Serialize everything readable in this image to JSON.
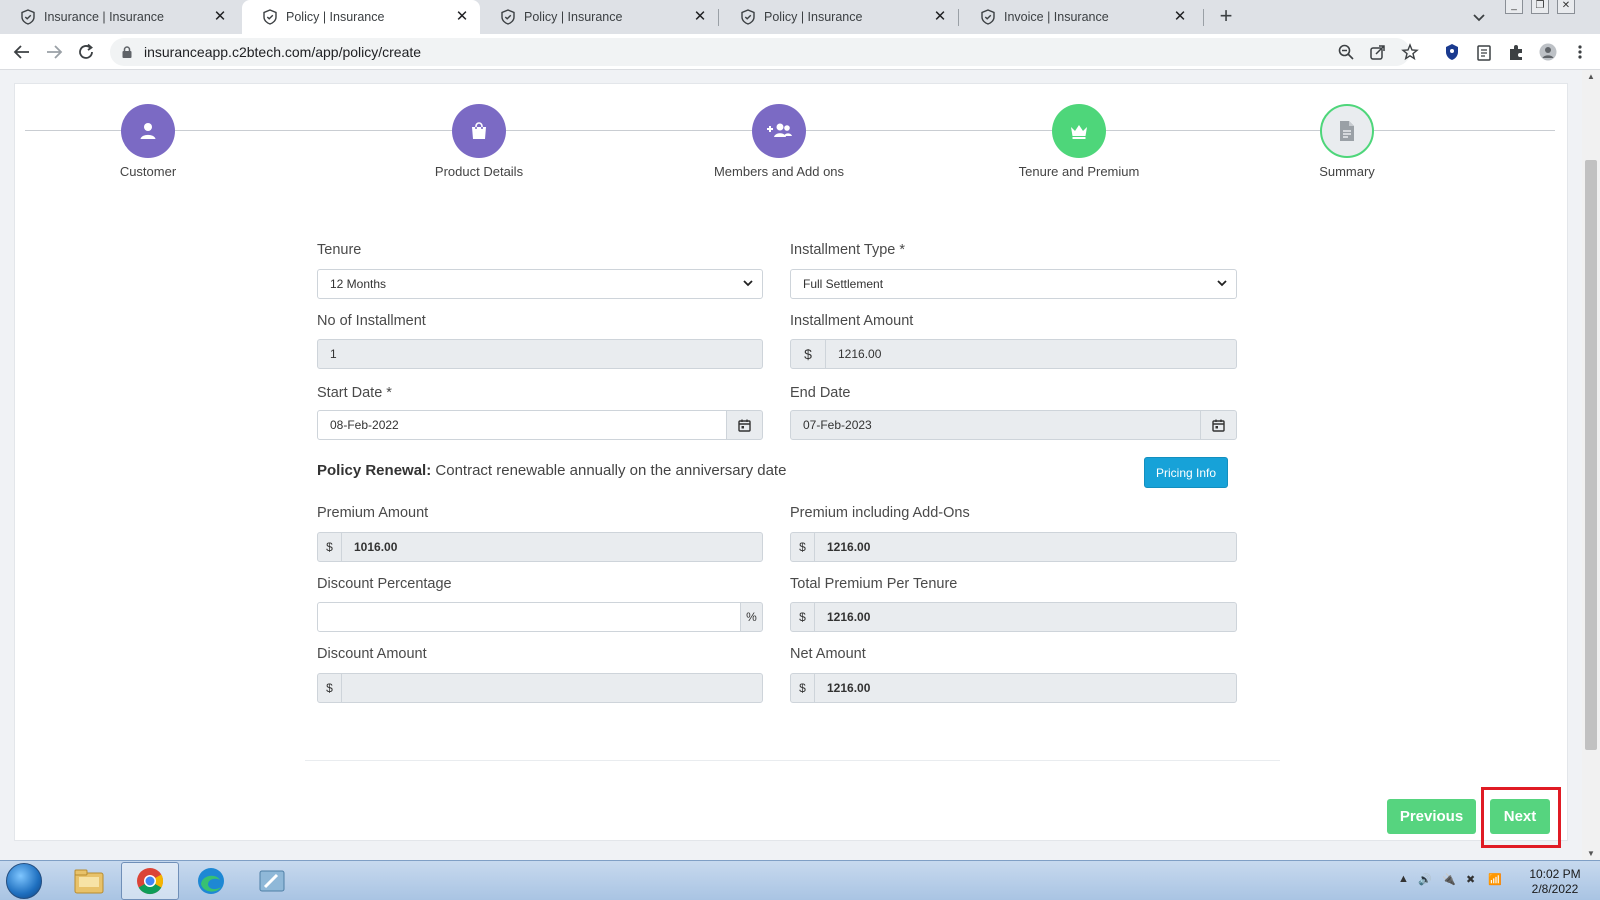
{
  "browser": {
    "tabs": [
      {
        "title": "Insurance | Insurance",
        "active": false
      },
      {
        "title": "Policy | Insurance",
        "active": true
      },
      {
        "title": "Policy | Insurance",
        "active": false
      },
      {
        "title": "Policy | Insurance",
        "active": false
      },
      {
        "title": "Invoice | Insurance",
        "active": false
      }
    ],
    "url": "insuranceapp.c2btech.com/app/policy/create"
  },
  "stepper": {
    "steps": [
      {
        "label": "Customer",
        "state": "done",
        "icon": "user-icon"
      },
      {
        "label": "Product Details",
        "state": "done",
        "icon": "shopping-bag-icon"
      },
      {
        "label": "Members and Add ons",
        "state": "done",
        "icon": "users-plus-icon"
      },
      {
        "label": "Tenure and Premium",
        "state": "current",
        "icon": "crown-icon"
      },
      {
        "label": "Summary",
        "state": "pending",
        "icon": "document-icon"
      }
    ],
    "colors": {
      "done": "#7b6ac4",
      "current": "#4ed67a"
    }
  },
  "form": {
    "tenure": {
      "label": "Tenure",
      "value": "12 Months"
    },
    "installment_type": {
      "label": "Installment Type *",
      "value": "Full Settlement"
    },
    "no_of_installment": {
      "label": "No of Installment",
      "value": "1"
    },
    "installment_amount": {
      "label": "Installment Amount",
      "currency": "$",
      "value": "1216.00"
    },
    "start_date": {
      "label": "Start Date *",
      "value": "08-Feb-2022"
    },
    "end_date": {
      "label": "End Date",
      "value": "07-Feb-2023"
    },
    "policy_renewal": {
      "label": "Policy Renewal:",
      "text": "Contract renewable annually on the anniversary date"
    },
    "pricing_info_label": "Pricing Info",
    "premium_amount": {
      "label": "Premium Amount",
      "currency": "$",
      "value": "1016.00"
    },
    "premium_incl_addons": {
      "label": "Premium including Add-Ons",
      "currency": "$",
      "value": "1216.00"
    },
    "discount_percentage": {
      "label": "Discount Percentage",
      "suffix": "%",
      "value": ""
    },
    "total_premium_per_tenure": {
      "label": "Total Premium Per Tenure",
      "currency": "$",
      "value": "1216.00"
    },
    "discount_amount": {
      "label": "Discount Amount",
      "currency": "$",
      "value": ""
    },
    "net_amount": {
      "label": "Net Amount",
      "currency": "$",
      "value": "1216.00"
    }
  },
  "actions": {
    "previous_label": "Previous",
    "next_label": "Next",
    "accent": "#56d47f",
    "highlight": "#e01b24"
  },
  "taskbar": {
    "time": "10:02 PM",
    "date": "2/8/2022"
  }
}
